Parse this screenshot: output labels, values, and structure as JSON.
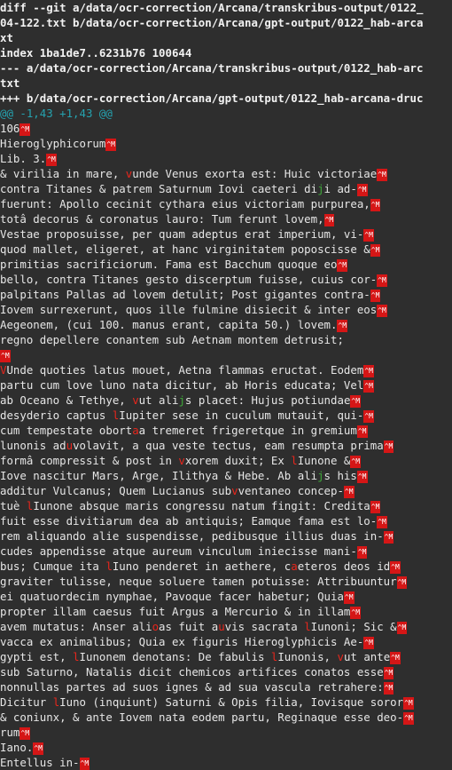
{
  "terminal": {
    "header_lines": [
      "diff --git a/data/ocr-correction/Arcana/transkribus-output/0122_",
      "04-122.txt b/data/ocr-correction/Arcana/gpt-output/0122_hab-arca",
      "xt",
      "index 1ba1de7..6231b76 100644",
      "--- a/data/ocr-correction/Arcana/transkribus-output/0122_hab-arc",
      "txt",
      "+++ b/data/ocr-correction/Arcana/gpt-output/0122_hab-arcana-druc"
    ],
    "hunk": "@@ -1,43 +1,43 @@",
    "body_lines": [
      [
        {
          "t": "106"
        },
        {
          "cr": "^M"
        }
      ],
      [
        {
          "t": "Hieroglyphicorum"
        },
        {
          "cr": "^M"
        }
      ],
      [
        {
          "t": "Lib. 3."
        },
        {
          "cr": "^M"
        }
      ],
      [
        {
          "t": "& virilia in mare, "
        },
        {
          "r": "v"
        },
        {
          "t": "unde Venus exorta est: Huic victoriae"
        },
        {
          "cr": "^M"
        }
      ],
      [
        {
          "t": "contra Titanes & patrem Saturnum Iovi caeteri di"
        },
        {
          "g": "j"
        },
        {
          "t": "i ad-"
        },
        {
          "cr": "^M"
        }
      ],
      [
        {
          "t": "fuerunt: Apollo cecinit cythara eius victoriam purpurea,"
        },
        {
          "cr": "^M"
        }
      ],
      [
        {
          "t": "totâ decorus & coronatus lauro: Tum ferunt lovem,"
        },
        {
          "cr": "^M"
        }
      ],
      [
        {
          "t": "Vestae proposuisse, per quam adeptus erat imperium, vi-"
        },
        {
          "cr": "^M"
        }
      ],
      [
        {
          "t": "quod mallet, eligeret, at hanc virginitatem poposcisse &"
        },
        {
          "cr": "^M"
        }
      ],
      [
        {
          "t": "primitias sacrificiorum. Fama est Bacchum quoque eo"
        },
        {
          "cr": "^M"
        }
      ],
      [
        {
          "t": "bello, contra Titanes gesto discerptum fuisse, cuius cor-"
        },
        {
          "cr": "^M"
        }
      ],
      [
        {
          "t": "palpitans Pallas ad lovem detulit; Post gigantes contra-"
        },
        {
          "cr": "^M"
        }
      ],
      [
        {
          "t": "Iovem surrexerunt, quos ille fulmine disiecit & inter eos"
        },
        {
          "cr": "^M"
        }
      ],
      [
        {
          "t": "Aegeonem, (cui 100. manus erant, capita 50.) lovem."
        },
        {
          "cr": "^M"
        }
      ],
      [
        {
          "t": "regno depellere conantem sub Aetnam montem detrusit;"
        }
      ],
      [
        {
          "cr": "^M"
        }
      ],
      [
        {
          "r": "V"
        },
        {
          "t": "Unde quoties latus mouet, Aetna flammas eructat. Eodem"
        },
        {
          "cr": "^M"
        }
      ],
      [
        {
          "t": "partu cum love luno nata dicitur, ab Horis educata; Vel"
        },
        {
          "cr": "^M"
        }
      ],
      [
        {
          "t": "ab Oceano & Tethye, "
        },
        {
          "r": "v"
        },
        {
          "t": "ut ali"
        },
        {
          "g": "j"
        },
        {
          "t": "s placet: Hujus potiundae"
        },
        {
          "cr": "^M"
        }
      ],
      [
        {
          "t": "desyderio captus "
        },
        {
          "r": "l"
        },
        {
          "t": "Iupiter sese in cuculum mutauit, qui-"
        },
        {
          "cr": "^M"
        }
      ],
      [
        {
          "t": "cum tempestate obort"
        },
        {
          "r": "a"
        },
        {
          "t": "a tremeret frigeretque in gremium"
        },
        {
          "cr": "^M"
        }
      ],
      [
        {
          "t": "lunonis ad"
        },
        {
          "r": "u"
        },
        {
          "t": "volavit, a qua veste tectus, eam resumpta prima"
        },
        {
          "cr": "^M"
        }
      ],
      [
        {
          "t": "formâ compressit & post in "
        },
        {
          "r": "v"
        },
        {
          "t": "xorem duxit; Ex "
        },
        {
          "r": "l"
        },
        {
          "t": "Iunone &"
        },
        {
          "cr": "^M"
        }
      ],
      [
        {
          "t": "Iove nascitur Mars, Arge, Ilithya & Hebe. Ab ali"
        },
        {
          "g": "j"
        },
        {
          "t": "s his"
        },
        {
          "cr": "^M"
        }
      ],
      [
        {
          "t": "additur Vulcanus; Quem Lucianus sub"
        },
        {
          "r": "v"
        },
        {
          "t": "ventaneo concep-"
        },
        {
          "cr": "^M"
        }
      ],
      [
        {
          "t": "tuè "
        },
        {
          "r": "l"
        },
        {
          "t": "Iunone absque maris congressu natum fingit: Credita"
        },
        {
          "cr": "^M"
        }
      ],
      [
        {
          "t": "fuit esse divitiarum dea ab antiquis; Eamque fama est lo-"
        },
        {
          "cr": "^M"
        }
      ],
      [
        {
          "t": "rem aliquando alie suspendisse, pedibusque illius duas in-"
        },
        {
          "cr": "^M"
        }
      ],
      [
        {
          "t": "cudes appendisse atque aureum vinculum iniecisse mani-"
        },
        {
          "cr": "^M"
        }
      ],
      [
        {
          "t": "bus; Cumque ita "
        },
        {
          "r": "l"
        },
        {
          "t": "Iuno penderet in aethere, c"
        },
        {
          "r": "a"
        },
        {
          "t": "eteros deos id"
        },
        {
          "cr": "^M"
        }
      ],
      [
        {
          "t": "graviter tulisse, neque soluere tamen potuisse: Attribuuntur"
        },
        {
          "cr": "^M"
        }
      ],
      [
        {
          "t": "ei quatuordecim nymphae, Pavoque facer habetur; Quia"
        },
        {
          "cr": "^M"
        }
      ],
      [
        {
          "t": "propter illam caesus fuit Argus a Mercurio & in illam"
        },
        {
          "cr": "^M"
        }
      ],
      [
        {
          "t": "avem mutatus: Anser ali"
        },
        {
          "r": "o"
        },
        {
          "t": "as fuit a"
        },
        {
          "r": "u"
        },
        {
          "t": "vis sacrata "
        },
        {
          "r": "l"
        },
        {
          "t": "Iunoni; Sic &"
        },
        {
          "cr": "^M"
        }
      ],
      [
        {
          "t": "vacca ex animalibus; Quia ex figuris Hieroglyphicis Ae-"
        },
        {
          "cr": "^M"
        }
      ],
      [
        {
          "t": "gypti est, "
        },
        {
          "r": "l"
        },
        {
          "t": "Iunonem denotans: De fabulis "
        },
        {
          "r": "l"
        },
        {
          "t": "Iunonis, "
        },
        {
          "r": "v"
        },
        {
          "t": "ut ante"
        },
        {
          "cr": "^M"
        }
      ],
      [
        {
          "t": "sub Saturno, Natalis dicit chemicos artifices conatos esse"
        },
        {
          "cr": "^M"
        }
      ],
      [
        {
          "t": "nonnullas partes ad suos ignes & ad sua vascula retrahere:"
        },
        {
          "cr": "^M"
        }
      ],
      [
        {
          "t": "Dicitur "
        },
        {
          "r": "l"
        },
        {
          "t": "Iuno (inquiunt) Saturni & Opis filia, Iovisque soror"
        },
        {
          "cr": "^M"
        }
      ],
      [
        {
          "t": "& coniunx, & ante Iovem nata eodem partu, Reginaque esse deo-"
        },
        {
          "cr": "^M"
        }
      ],
      [
        {
          "t": "rum"
        },
        {
          "cr": "^M"
        }
      ],
      [
        {
          "t": "Iano."
        },
        {
          "cr": "^M"
        }
      ],
      [
        {
          "t": "Entellus in-"
        },
        {
          "cr": "^M"
        }
      ]
    ]
  },
  "colors": {
    "background": "#2e2e2e",
    "hunk": "#25a3b0",
    "removed": "#e9261c",
    "added": "#3ea83a",
    "whitespace_error_bg": "#d51616"
  }
}
